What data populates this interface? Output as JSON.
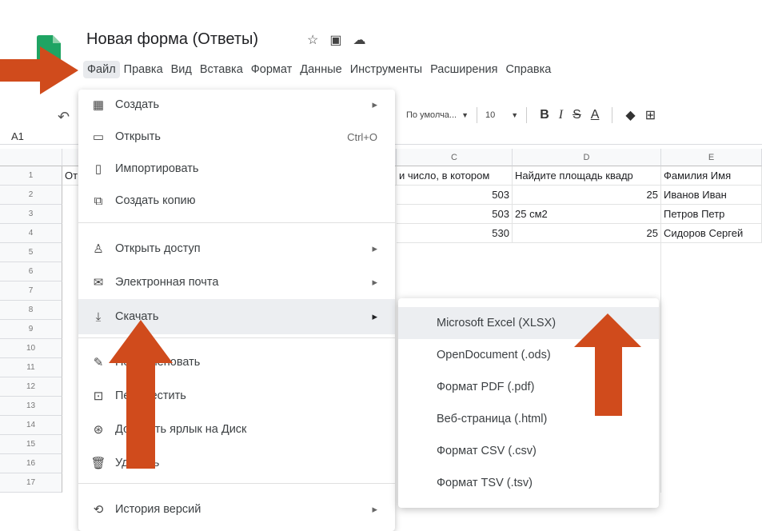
{
  "header": {
    "title": "Новая форма (Ответы)",
    "icons": [
      "star-icon",
      "folder-icon",
      "cloud-icon"
    ]
  },
  "menubar": [
    "Файл",
    "Правка",
    "Вид",
    "Вставка",
    "Формат",
    "Данные",
    "Инструменты",
    "Расширения",
    "Справка"
  ],
  "toolbar": {
    "font": "По умолча...",
    "size": "10",
    "bold": "B",
    "italic": "I",
    "strike": "S",
    "underline": "A"
  },
  "cell_ref": "A1",
  "grid": {
    "columns": [
      "C",
      "D",
      "E"
    ],
    "row_numbers": [
      "1",
      "2",
      "3",
      "4",
      "5",
      "6",
      "7",
      "8",
      "9",
      "10",
      "11",
      "12",
      "13",
      "14",
      "15",
      "16",
      "17"
    ],
    "row1_a_fragment": "От",
    "rows": [
      [
        "и число, в котором",
        "Найдите площадь квадр",
        "Фамилия Имя"
      ],
      [
        "503",
        "25",
        "Иванов Иван"
      ],
      [
        "503",
        "25 см2",
        "Петров Петр"
      ],
      [
        "530",
        "25",
        "Сидоров Сергей"
      ]
    ]
  },
  "file_menu": {
    "items": [
      {
        "icon": "sheet-icon",
        "label": "Создать",
        "tail": "▸"
      },
      {
        "icon": "folder-open-icon",
        "label": "Открыть",
        "tail": "Ctrl+O"
      },
      {
        "icon": "file-icon",
        "label": "Импортировать",
        "tail": ""
      },
      {
        "icon": "copy-icon",
        "label": "Создать копию",
        "tail": ""
      },
      {
        "icon": "share-icon",
        "label": "Открыть доступ",
        "tail": "▸"
      },
      {
        "icon": "mail-icon",
        "label": "Электронная почта",
        "tail": "▸"
      },
      {
        "icon": "download-icon",
        "label": "Скачать",
        "tail": "▸"
      },
      {
        "icon": "rename-icon",
        "label": "Переименовать",
        "tail": ""
      },
      {
        "icon": "move-icon",
        "label": "Переместить",
        "tail": ""
      },
      {
        "icon": "drive-shortcut-icon",
        "label": "Добавить ярлык на Диск",
        "tail": ""
      },
      {
        "icon": "trash-icon",
        "label": "Удалить",
        "tail": ""
      },
      {
        "icon": "history-icon",
        "label": "История версий",
        "tail": "▸"
      }
    ]
  },
  "download_submenu": [
    "Microsoft Excel (XLSX)",
    "OpenDocument (.ods)",
    "Формат PDF (.pdf)",
    "Веб-страница (.html)",
    "Формат CSV (.csv)",
    "Формат TSV (.tsv)"
  ],
  "colors": {
    "arrow": "#d04b1c",
    "logo_green": "#1fa463",
    "highlight": "#eceef1"
  }
}
